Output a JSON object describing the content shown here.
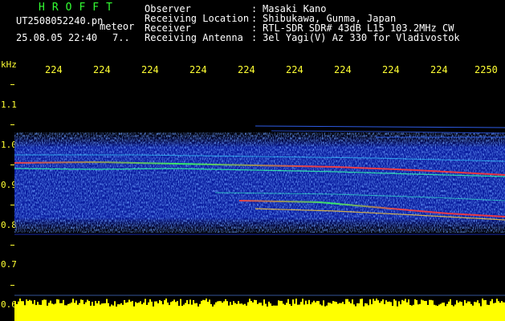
{
  "header": {
    "brand": "HROFFT",
    "filename": "UT2508052240.pn",
    "mode": "meteor",
    "datetime": "25.08.05 22:40",
    "extra": "7..",
    "fields": [
      {
        "key": "Observer",
        "value": "Masaki Kano"
      },
      {
        "key": "Receiving Location",
        "value": "Shibukawa, Gunma, Japan"
      },
      {
        "key": "Receiver",
        "value": "RTL-SDR SDR# 43dB L15 103.2MHz CW"
      },
      {
        "key": "Receiving Antenna",
        "value": "3el Yagi(V) Az 330 for Vladivostok"
      }
    ]
  },
  "axes": {
    "y_unit": "kHz",
    "y_labels": [
      "1.1",
      "1.0",
      "0.9",
      "0.8",
      "0.7",
      "0.6"
    ],
    "x_labels": [
      "224",
      "224",
      "224",
      "224",
      "224",
      "224",
      "224",
      "224",
      "224",
      "2250"
    ]
  },
  "colors": {
    "text": "#ffffff",
    "brand": "#33ff33",
    "axis": "#ffff33",
    "bg": "#000000"
  }
}
